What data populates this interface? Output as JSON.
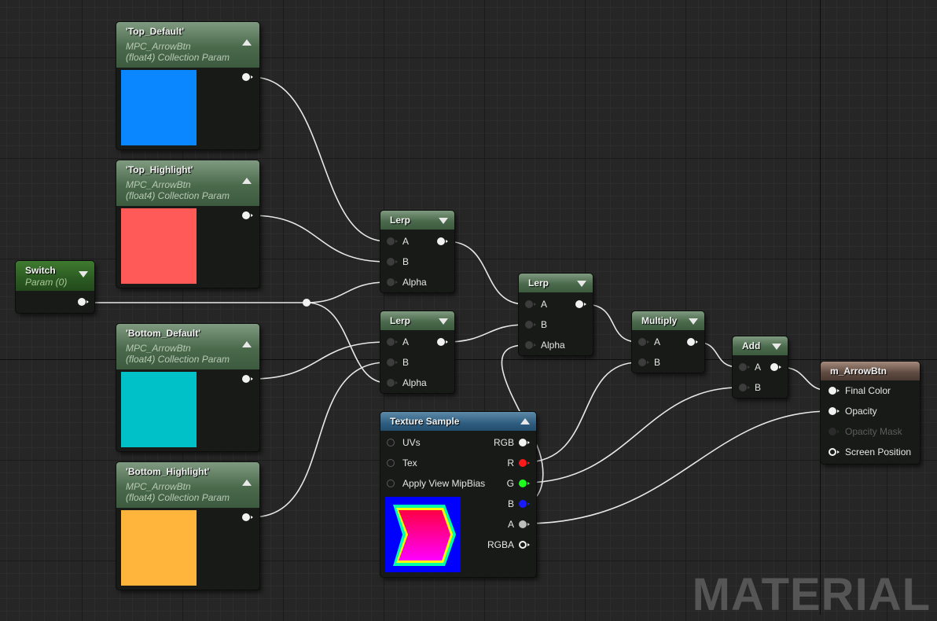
{
  "watermark": "MATERIAL",
  "nodes": {
    "top_default": {
      "title": "'Top_Default'",
      "collection": "MPC_ArrowBtn",
      "type": "(float4) Collection Param",
      "color": "#0a86ff"
    },
    "top_highlight": {
      "title": "'Top_Highlight'",
      "collection": "MPC_ArrowBtn",
      "type": "(float4) Collection Param",
      "color": "#ff5a58"
    },
    "bottom_default": {
      "title": "'Bottom_Default'",
      "collection": "MPC_ArrowBtn",
      "type": "(float4) Collection Param",
      "color": "#00c0c8"
    },
    "bottom_highlight": {
      "title": "'Bottom_Highlight'",
      "collection": "MPC_ArrowBtn",
      "type": "(float4) Collection Param",
      "color": "#ffb43c"
    },
    "switch": {
      "title": "Switch",
      "subtitle": "Param (0)"
    },
    "lerp1": {
      "title": "Lerp",
      "inputs": [
        "A",
        "B",
        "Alpha"
      ]
    },
    "lerp2": {
      "title": "Lerp",
      "inputs": [
        "A",
        "B",
        "Alpha"
      ]
    },
    "lerp3": {
      "title": "Lerp",
      "inputs": [
        "A",
        "B",
        "Alpha"
      ]
    },
    "multiply": {
      "title": "Multiply",
      "inputs": [
        "A",
        "B"
      ]
    },
    "add": {
      "title": "Add",
      "inputs": [
        "A",
        "B"
      ]
    },
    "texture_sample": {
      "title": "Texture Sample",
      "inputs": [
        "UVs",
        "Tex",
        "Apply View MipBias"
      ],
      "outputs": [
        "RGB",
        "R",
        "G",
        "B",
        "A",
        "RGBA"
      ]
    },
    "output": {
      "title": "m_ArrowBtn",
      "inputs": [
        "Final Color",
        "Opacity",
        "Opacity Mask",
        "Screen Position"
      ]
    }
  },
  "colors": {
    "wire": "#e8e8e8",
    "pin_r": "#ff1a1a",
    "pin_g": "#1cff1c",
    "pin_b": "#1a1aff"
  }
}
